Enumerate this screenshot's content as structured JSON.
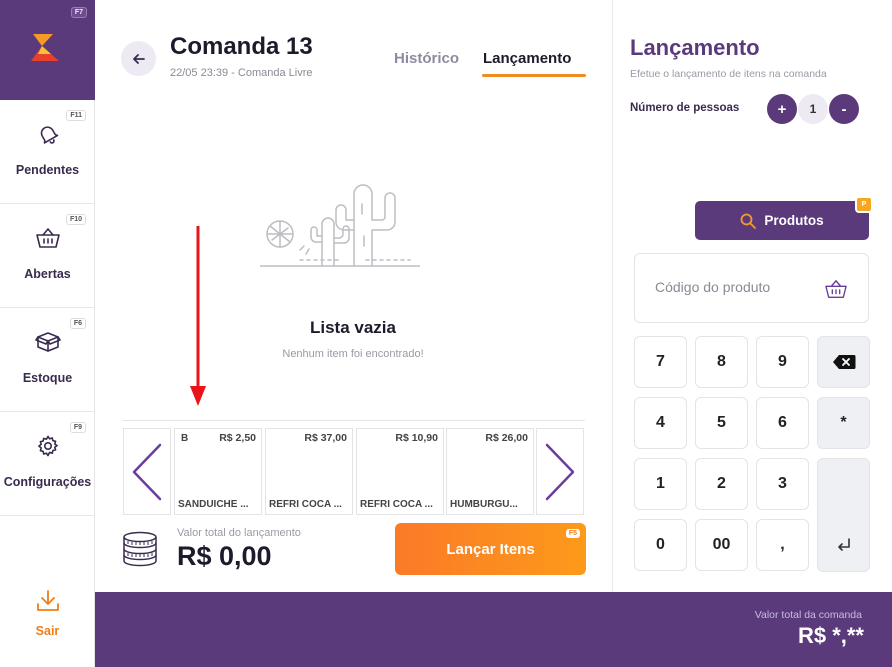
{
  "sidebar": {
    "logo_fkey": "F7",
    "items": [
      {
        "label": "Pendentes",
        "fkey": "F11"
      },
      {
        "label": "Abertas",
        "fkey": "F10"
      },
      {
        "label": "Estoque",
        "fkey": "F6"
      },
      {
        "label": "Configurações",
        "fkey": "F9"
      }
    ],
    "exit_label": "Sair"
  },
  "header": {
    "title": "Comanda 13",
    "subtitle": "22/05 23:39 - Comanda Livre",
    "tabs": [
      {
        "label": "Histórico",
        "active": false
      },
      {
        "label": "Lançamento",
        "active": true
      }
    ]
  },
  "empty_state": {
    "title": "Lista vazia",
    "message": "Nenhum item foi encontrado!"
  },
  "products": [
    {
      "code": "B",
      "price": "R$ 2,50",
      "name": "SANDUICHE ..."
    },
    {
      "code": "",
      "price": "R$ 37,00",
      "name": "REFRI COCA ..."
    },
    {
      "code": "",
      "price": "R$ 10,90",
      "name": "REFRI COCA ..."
    },
    {
      "code": "",
      "price": "R$ 26,00",
      "name": "HUMBURGU..."
    }
  ],
  "totals": {
    "label": "Valor total do lançamento",
    "value": "R$ 0,00"
  },
  "launch_button": {
    "label": "Lançar Itens",
    "fkey": "F5"
  },
  "right_panel": {
    "title": "Lançamento",
    "subtitle": "Efetue o lançamento de itens na comanda",
    "people_label": "Número de pessoas",
    "people_count": "1",
    "plus_label": "+",
    "minus_label": "-",
    "products_button": "Produtos",
    "products_badge": "P",
    "code_placeholder": "Código do produto"
  },
  "keypad": {
    "keys": [
      "7",
      "8",
      "9",
      "4",
      "5",
      "6",
      "1",
      "2",
      "3",
      "0",
      "00",
      ","
    ],
    "star": "*"
  },
  "bottom_bar": {
    "label": "Valor total da comanda",
    "value": "R$ *,**"
  },
  "colors": {
    "brand_purple": "#5b3a7c",
    "accent_orange": "#f28a22"
  }
}
